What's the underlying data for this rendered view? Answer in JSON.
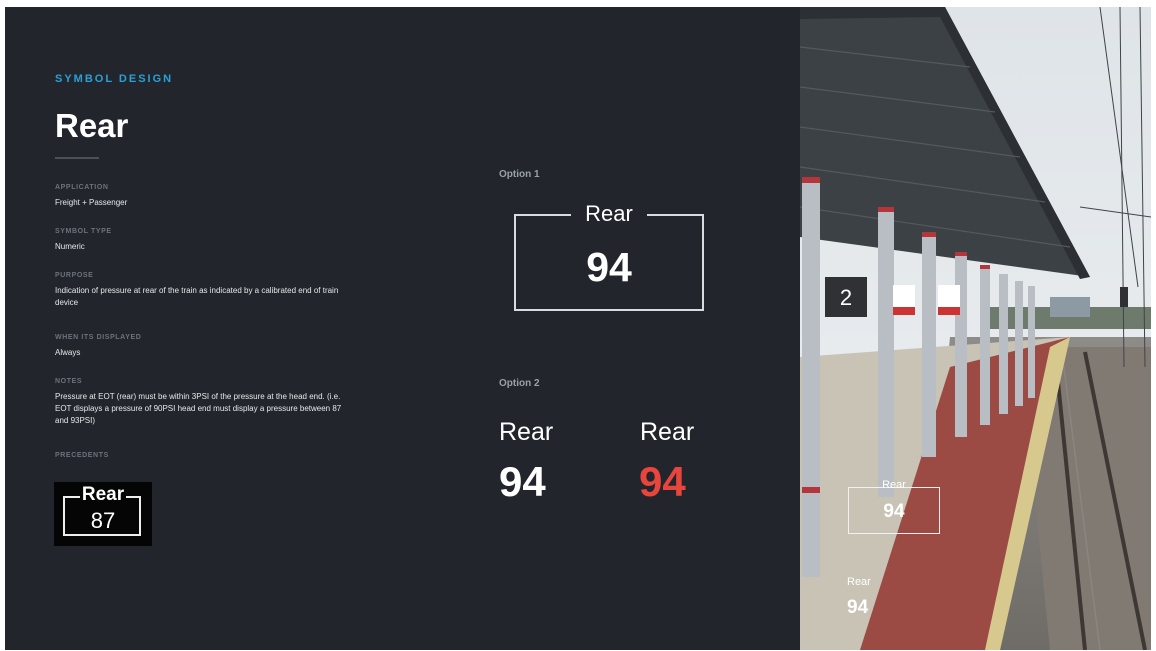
{
  "left": {
    "eyebrow": "SYMBOL DESIGN",
    "title": "Rear",
    "sections": [
      {
        "label": "APPLICATION",
        "value": "Freight + Passenger"
      },
      {
        "label": "SYMBOL TYPE",
        "value": "Numeric"
      },
      {
        "label": "PURPOSE",
        "value": "Indication of pressure at rear of the train as indicated by a calibrated end of train device"
      },
      {
        "label": "WHEN ITS DISPLAYED",
        "value": "Always"
      },
      {
        "label": "NOTES",
        "value": "Pressure at EOT (rear) must be within 3PSI of the pressure at the head end. (i.e. EOT displays a pressure of 90PSI head end must display a pressure between 87 and 93PSI)"
      },
      {
        "label": "PRECEDENTS",
        "value": ""
      }
    ],
    "precedent": {
      "label": "Rear",
      "value": "87"
    }
  },
  "options": {
    "option1": {
      "heading": "Option 1",
      "label": "Rear",
      "value": "94"
    },
    "option2": {
      "heading": "Option 2",
      "items": [
        {
          "label": "Rear",
          "value": "94",
          "color": "#ffffff"
        },
        {
          "label": "Rear",
          "value": "94",
          "color": "#e8453c"
        }
      ]
    }
  },
  "photo": {
    "platform_number": "2",
    "overlay_boxed": {
      "label": "Rear",
      "value": "94"
    },
    "overlay_plain": {
      "label": "Rear",
      "value": "94"
    }
  },
  "colors": {
    "background": "#22262c",
    "accent": "#2b9fd6",
    "alert": "#e8453c"
  }
}
